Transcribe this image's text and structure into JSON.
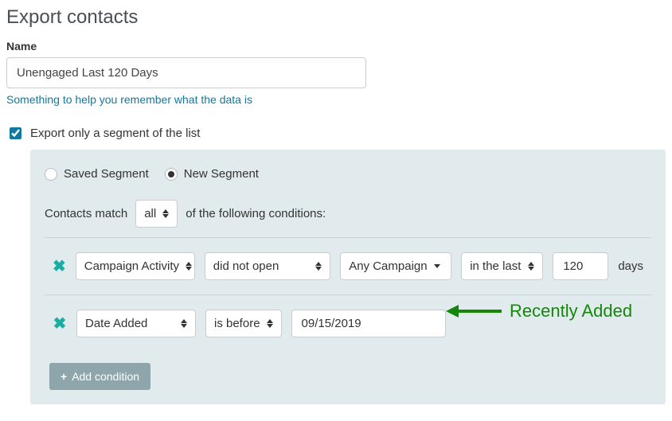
{
  "page_title": "Export contacts",
  "name_field": {
    "label": "Name",
    "value": "Unengaged Last 120 Days",
    "help_text": "Something to help you remember what the data is"
  },
  "export_segment_checkbox": {
    "label": "Export only a segment of the list",
    "checked": true
  },
  "segment_type": {
    "saved_label": "Saved Segment",
    "new_label": "New Segment",
    "selected": "new"
  },
  "match": {
    "prefix": "Contacts match",
    "selector_value": "all",
    "suffix": "of the following conditions:"
  },
  "conditions": [
    {
      "field": "Campaign Activity",
      "operator": "did not open",
      "campaign": "Any Campaign",
      "time_qualifier": "in the last",
      "value": "120",
      "unit": "days"
    },
    {
      "field": "Date Added",
      "operator": "is before",
      "date": "09/15/2019"
    }
  ],
  "add_condition_label": "Add condition",
  "annotation_text": "Recently Added"
}
